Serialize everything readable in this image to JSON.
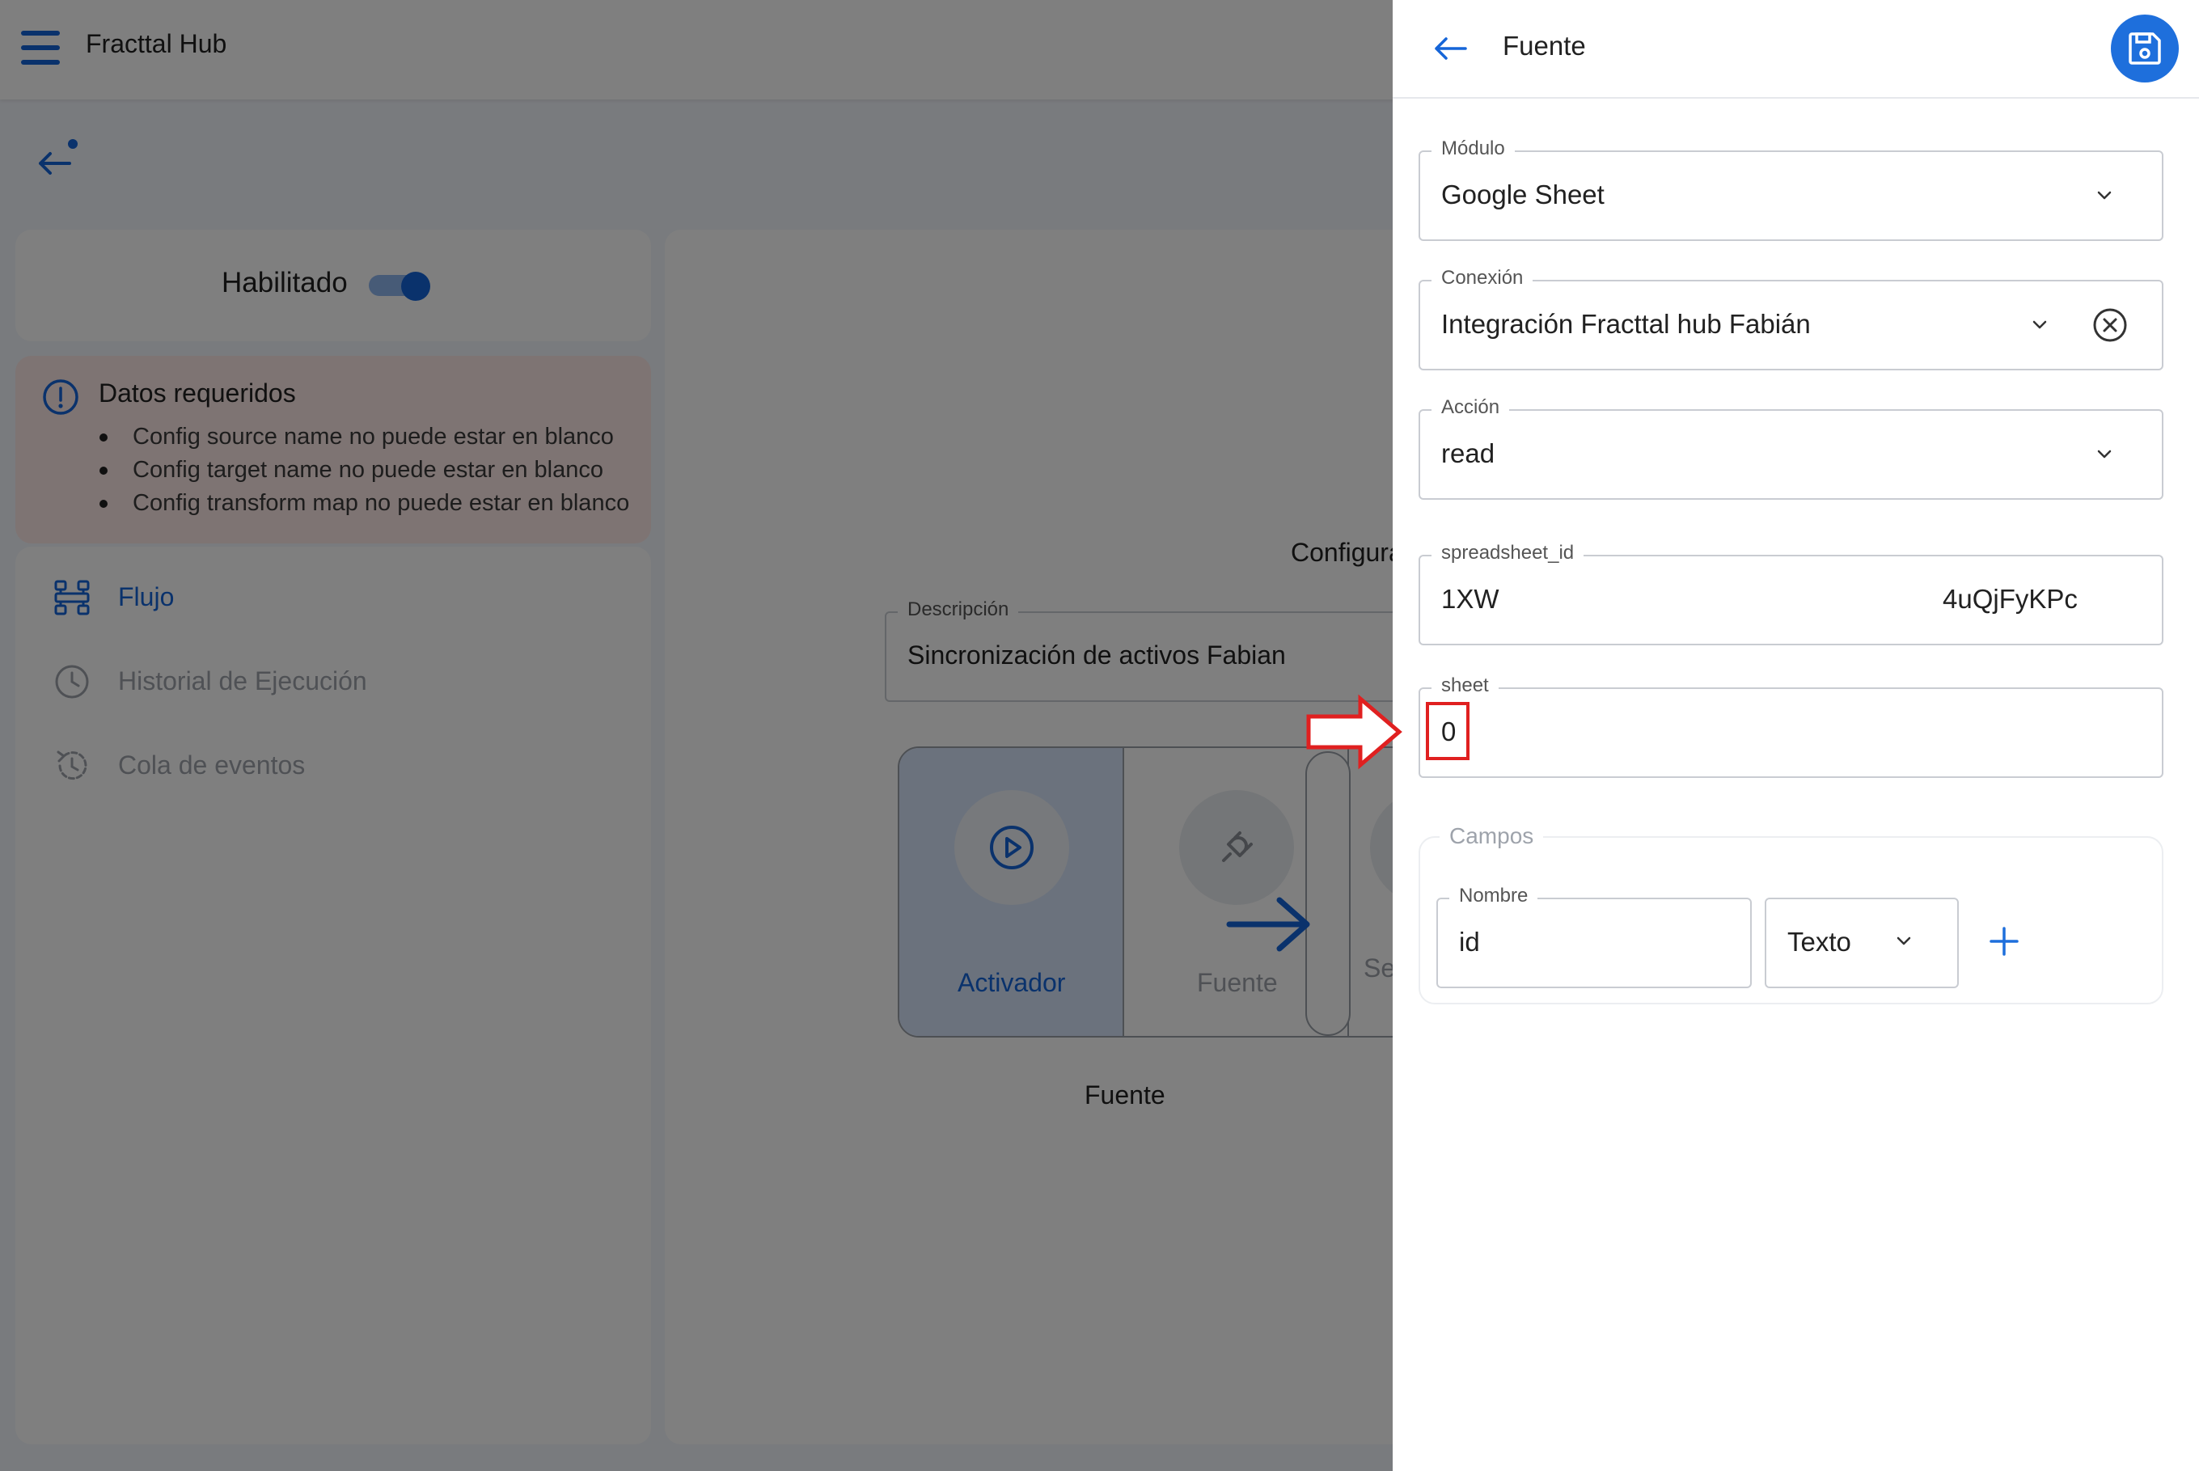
{
  "app": {
    "title": "Fracttal Hub",
    "enabled_label": "Habilitado",
    "enabled": true
  },
  "alert": {
    "title": "Datos requeridos",
    "items": [
      "Config source name no puede estar en blanco",
      "Config target name no puede estar en blanco",
      "Config transform map no puede estar en blanco"
    ]
  },
  "nav": {
    "items": [
      {
        "label": "Flujo",
        "icon": "flow-icon",
        "active": true
      },
      {
        "label": "Historial de Ejecución",
        "icon": "clock-icon",
        "active": false
      },
      {
        "label": "Cola de eventos",
        "icon": "history-icon",
        "active": false
      }
    ]
  },
  "main": {
    "config_title": "Configura",
    "description_label": "Descripción",
    "description_value": "Sincronización de activos Fabian",
    "steps": [
      {
        "label": "Activador",
        "icon": "play-icon",
        "active": true
      },
      {
        "label": "Fuente",
        "icon": "plug-icon",
        "active": false
      },
      {
        "label": "Se",
        "icon": "",
        "active": false
      }
    ],
    "flow_caption": "Fuente"
  },
  "drawer": {
    "title": "Fuente",
    "save_icon": "save-icon",
    "modulo": {
      "label": "Módulo",
      "value": "Google Sheet"
    },
    "conexion": {
      "label": "Conexión",
      "value": "Integración Fracttal hub Fabián"
    },
    "accion": {
      "label": "Acción",
      "value": "read"
    },
    "spreadsheet": {
      "label": "spreadsheet_id",
      "value_start": "1XW",
      "value_end": "4uQjFyKPc"
    },
    "sheet": {
      "label": "sheet",
      "value": "0"
    },
    "campos": {
      "label": "Campos",
      "nombre_label": "Nombre",
      "nombre_value": "id",
      "tipo_value": "Texto"
    }
  },
  "colors": {
    "accent": "#1565d8",
    "save_button": "#1e6fdc",
    "alert_bg": "#fde8e6",
    "highlight": "#e02020"
  }
}
